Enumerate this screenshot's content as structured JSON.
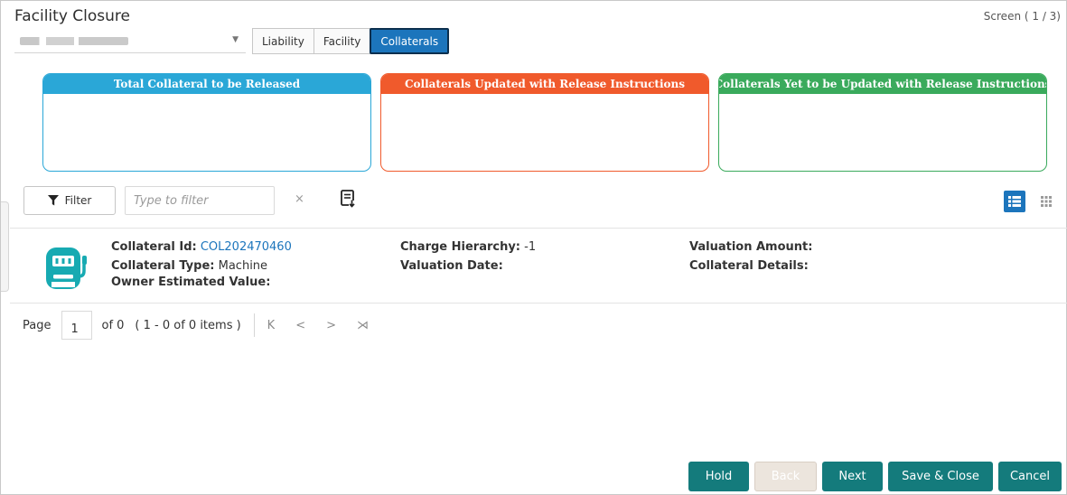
{
  "header": {
    "title": "Facility Closure",
    "screen_indicator": "Screen ( 1 / 3)"
  },
  "account_select": {
    "selected_value": "",
    "icon": "chevron-down-icon"
  },
  "tabs": [
    {
      "label": "Liability",
      "active": false
    },
    {
      "label": "Facility",
      "active": false
    },
    {
      "label": "Collaterals",
      "active": true
    }
  ],
  "summary_cards": [
    {
      "title": "Total Collateral to be Released",
      "color": "#2aa7d7"
    },
    {
      "title": "Collaterals Updated with Release Instructions",
      "color": "#f05a2c"
    },
    {
      "title": "Collaterals Yet to be Updated with Release Instructions",
      "color": "#3aaa5c"
    }
  ],
  "toolbar": {
    "filter_label": "Filter",
    "filter_placeholder": "Type to filter",
    "clear_symbol": "×",
    "icons": [
      "filter-icon",
      "export-icon",
      "list-view-icon",
      "grid-view-icon"
    ]
  },
  "record": {
    "icon": "machine-icon",
    "collateral_id_label": "Collateral Id:",
    "collateral_id_value": "COL202470460",
    "collateral_type_label": "Collateral Type:",
    "collateral_type_value": "Machine",
    "owner_estimated_value_label": "Owner Estimated Value:",
    "charge_hierarchy_label": "Charge Hierarchy:",
    "charge_hierarchy_value": "-1",
    "valuation_date_label": "Valuation Date:",
    "valuation_amount_label": "Valuation Amount:",
    "collateral_details_label": "Collateral Details:"
  },
  "pagination": {
    "page_label": "Page",
    "page_value": "1",
    "of_text": "of 0",
    "items_text": "( 1 - 0 of 0 items )",
    "first": "K",
    "prev": "<",
    "next": ">",
    "last": "⋊"
  },
  "footer_buttons": {
    "hold": "Hold",
    "back": "Back",
    "next": "Next",
    "save_close": "Save & Close",
    "cancel": "Cancel"
  }
}
